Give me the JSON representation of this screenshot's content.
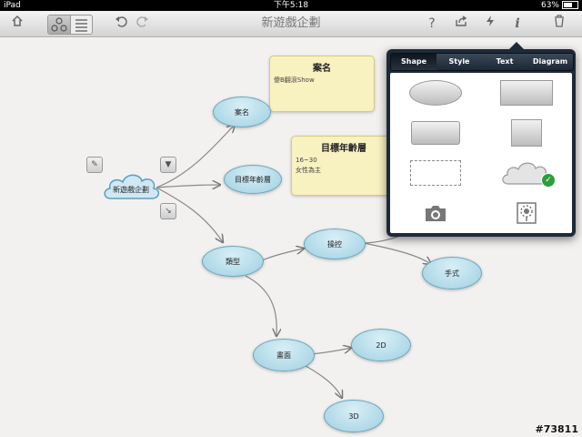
{
  "status_bar": {
    "carrier": "iPad",
    "time": "下午5:18",
    "battery": "63%"
  },
  "toolbar": {
    "title": "新遊戲企劃"
  },
  "nodes": {
    "root": "新遊戲企劃",
    "case": "案名",
    "age": "目標年齡層",
    "type": "類型",
    "control": "操控",
    "hand": "手式",
    "screen": "畫面",
    "d2": "2D",
    "d3": "3D"
  },
  "notes": {
    "case": {
      "title": "案名",
      "body": "傻B翻滾Show"
    },
    "age": {
      "title": "目標年齡層",
      "line1": "16~30",
      "line2": "女性為主"
    }
  },
  "popover": {
    "tabs": [
      "Shape",
      "Style",
      "Text",
      "Diagram"
    ],
    "active_tab": "Shape"
  },
  "watermark": "#73811"
}
